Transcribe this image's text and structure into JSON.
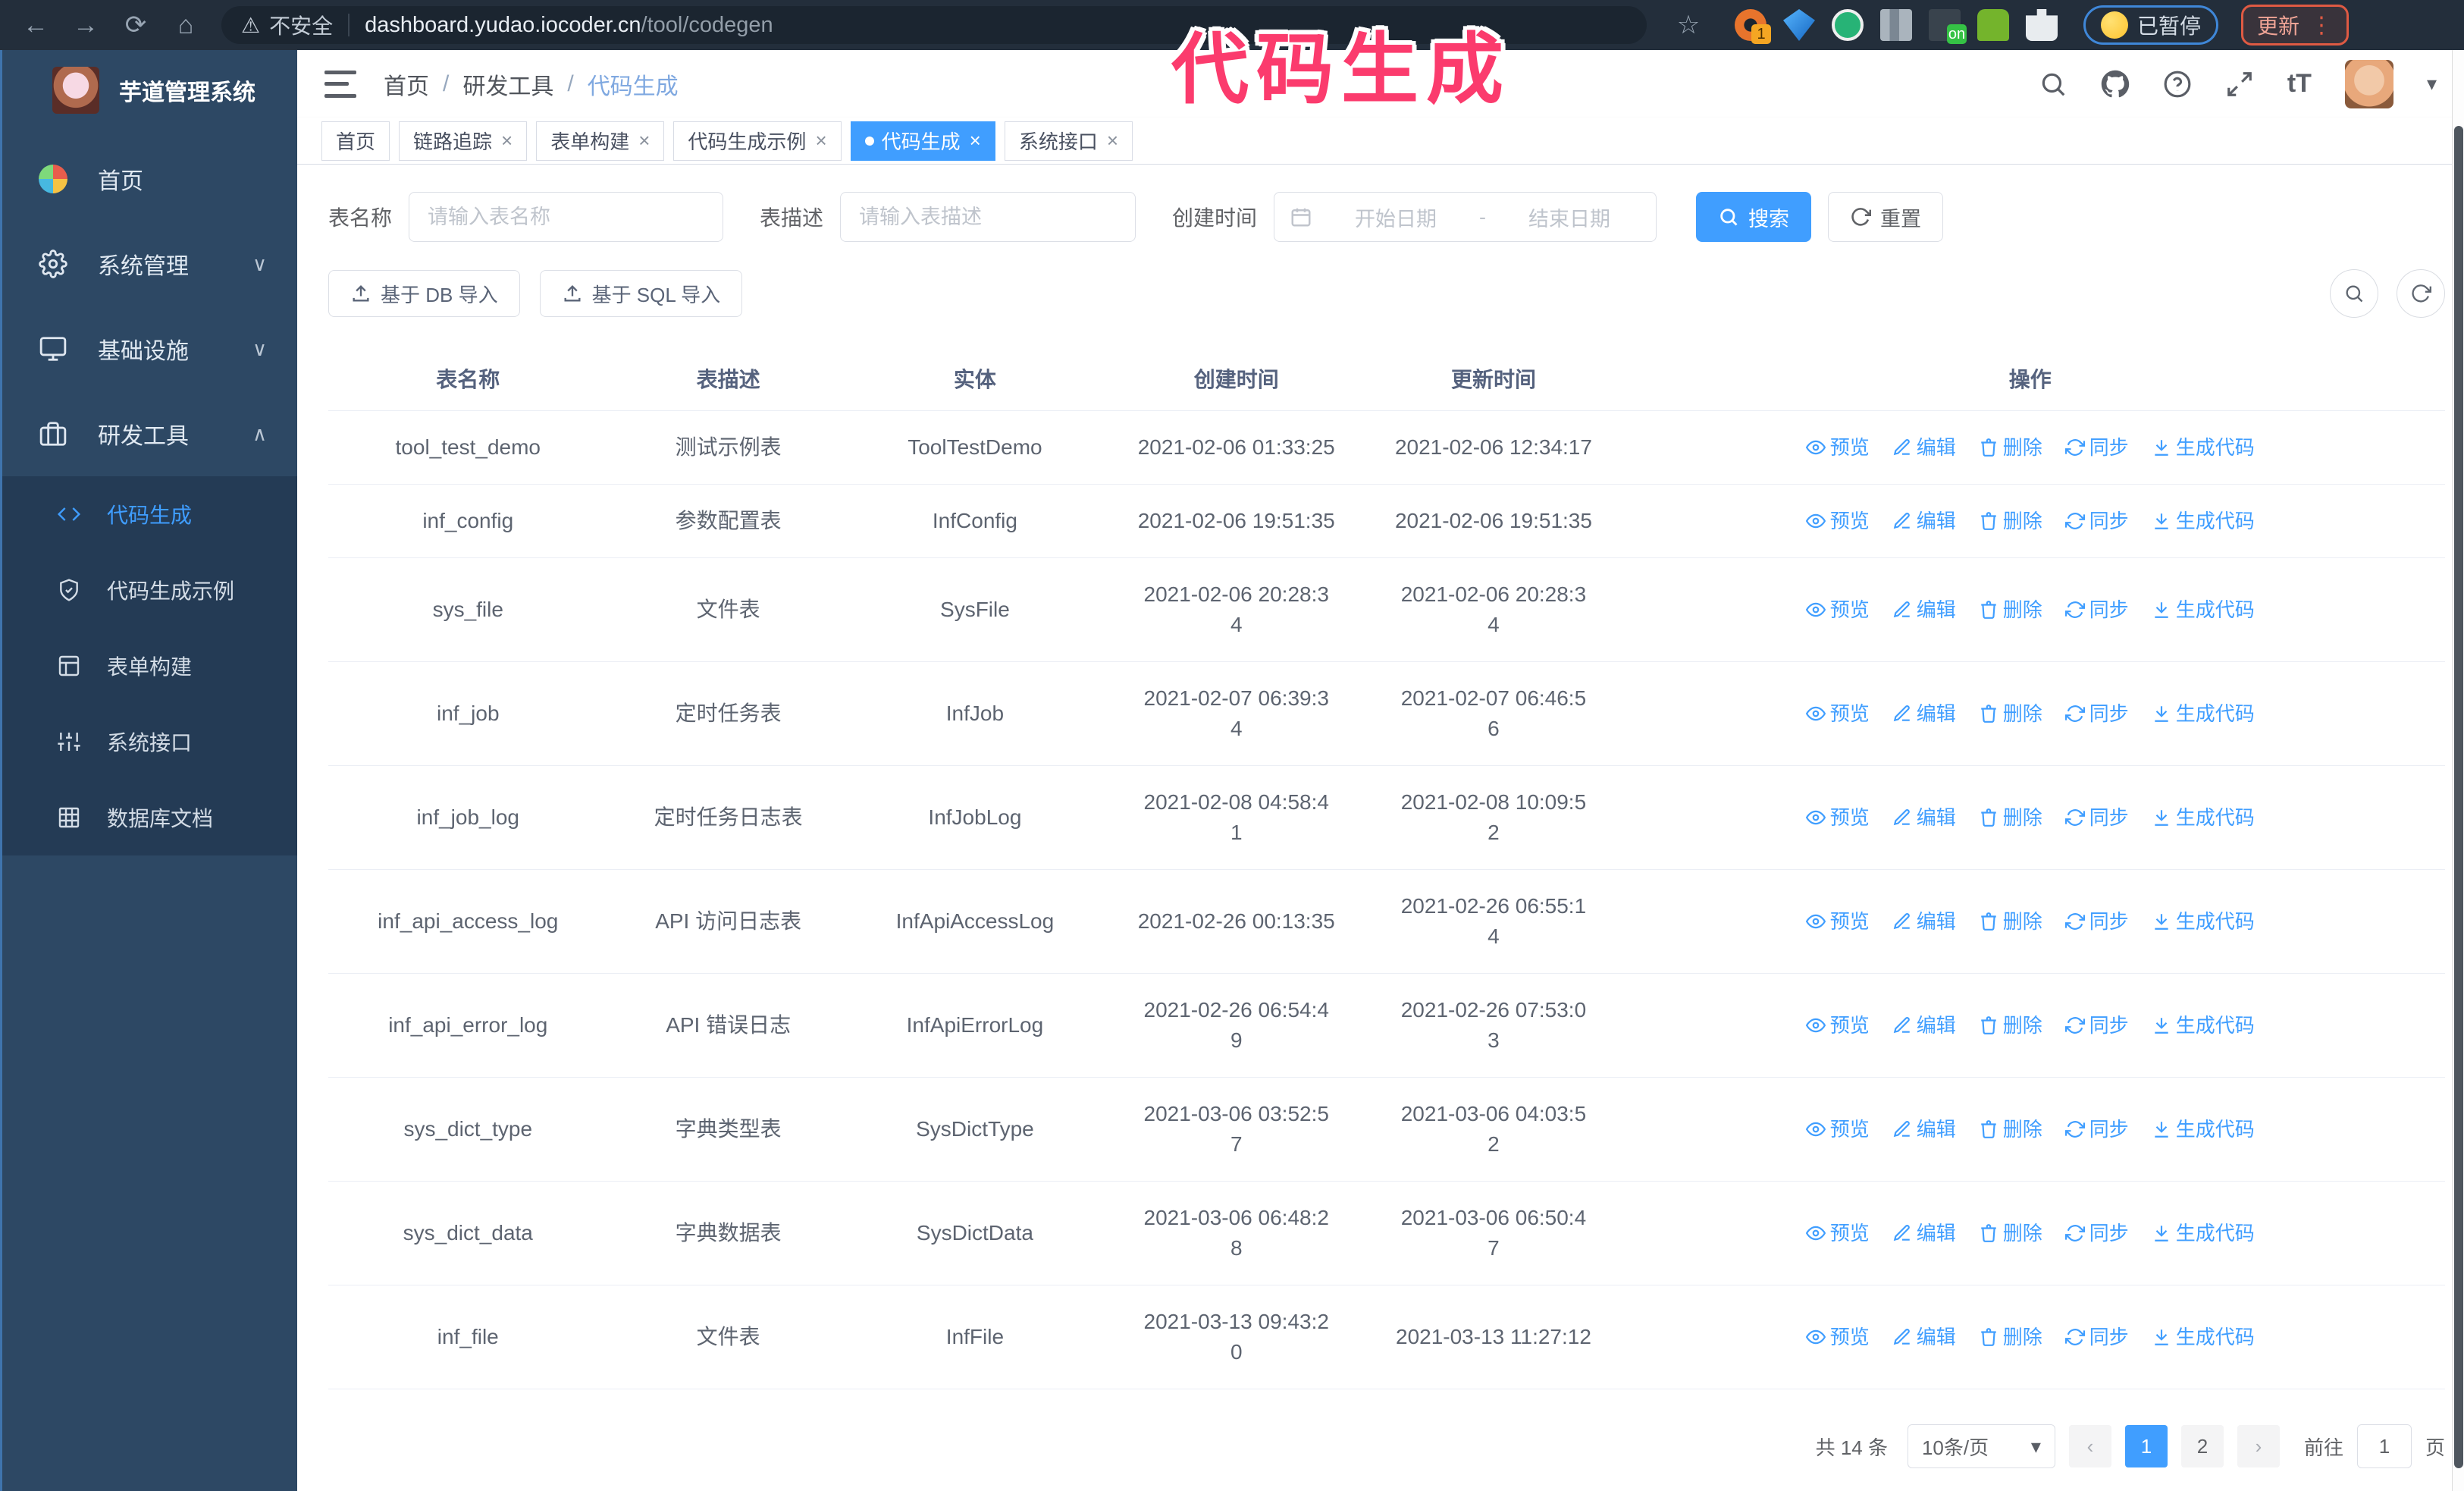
{
  "annotation": {
    "text": "代码生成",
    "color": "#fb3b6d"
  },
  "icons": {
    "back": "←",
    "forward": "→",
    "reload": "⟳",
    "home": "⌂",
    "warning": "⚠",
    "star": "☆",
    "kebab": "⋮",
    "caret_down": "▾",
    "close": "×",
    "chevron_down": "∨",
    "chevron_up": "∧",
    "prev_page": "‹",
    "next_page": "›"
  },
  "browser": {
    "insecure_label": "不安全",
    "url_host": "dashboard.yudao.iocoder.cn",
    "url_path": "/tool/codegen",
    "paused_badge": "已暂停",
    "update_button": "更新"
  },
  "sidebar": {
    "title": "芋道管理系统",
    "items": [
      {
        "label": "首页",
        "icon": "dashboard-pie"
      },
      {
        "label": "系统管理",
        "icon": "gear"
      },
      {
        "label": "基础设施",
        "icon": "monitor"
      },
      {
        "label": "研发工具",
        "icon": "briefcase"
      }
    ],
    "submenu": [
      {
        "label": "代码生成",
        "icon": "code",
        "active": true
      },
      {
        "label": "代码生成示例",
        "icon": "shield-check"
      },
      {
        "label": "表单构建",
        "icon": "form"
      },
      {
        "label": "系统接口",
        "icon": "sliders"
      },
      {
        "label": "数据库文档",
        "icon": "grid"
      }
    ]
  },
  "header": {
    "breadcrumb": [
      "首页",
      "研发工具",
      "代码生成"
    ],
    "separator": "/"
  },
  "tabs": [
    {
      "label": "首页"
    },
    {
      "label": "链路追踪",
      "closable": true
    },
    {
      "label": "表单构建",
      "closable": true
    },
    {
      "label": "代码生成示例",
      "closable": true
    },
    {
      "label": "代码生成",
      "closable": true,
      "active": true
    },
    {
      "label": "系统接口",
      "closable": true
    }
  ],
  "filters": {
    "table_name_label": "表名称",
    "table_name_placeholder": "请输入表名称",
    "table_desc_label": "表描述",
    "table_desc_placeholder": "请输入表描述",
    "create_time_label": "创建时间",
    "date_start_placeholder": "开始日期",
    "date_separator": "-",
    "date_end_placeholder": "结束日期",
    "search_label": "搜索",
    "reset_label": "重置"
  },
  "toolbar": {
    "import_db_label": "基于 DB 导入",
    "import_sql_label": "基于 SQL 导入"
  },
  "table": {
    "columns": [
      "表名称",
      "表描述",
      "实体",
      "创建时间",
      "更新时间",
      "操作"
    ],
    "row_actions": [
      "预览",
      "编辑",
      "删除",
      "同步",
      "生成代码"
    ],
    "rows": [
      {
        "name": "tool_test_demo",
        "desc": "测试示例表",
        "entity": "ToolTestDemo",
        "create_time": "2021-02-06 01:33:25",
        "update_time": "2021-02-06 12:34:17"
      },
      {
        "name": "inf_config",
        "desc": "参数配置表",
        "entity": "InfConfig",
        "create_time": "2021-02-06 19:51:35",
        "update_time": "2021-02-06 19:51:35"
      },
      {
        "name": "sys_file",
        "desc": "文件表",
        "entity": "SysFile",
        "create_time": "2021-02-06 20:28:3\n4",
        "update_time": "2021-02-06 20:28:3\n4"
      },
      {
        "name": "inf_job",
        "desc": "定时任务表",
        "entity": "InfJob",
        "create_time": "2021-02-07 06:39:3\n4",
        "update_time": "2021-02-07 06:46:5\n6"
      },
      {
        "name": "inf_job_log",
        "desc": "定时任务日志表",
        "entity": "InfJobLog",
        "create_time": "2021-02-08 04:58:4\n1",
        "update_time": "2021-02-08 10:09:5\n2"
      },
      {
        "name": "inf_api_access_log",
        "desc": "API 访问日志表",
        "entity": "InfApiAccessLog",
        "create_time": "2021-02-26 00:13:35",
        "update_time": "2021-02-26 06:55:1\n4"
      },
      {
        "name": "inf_api_error_log",
        "desc": "API 错误日志",
        "entity": "InfApiErrorLog",
        "create_time": "2021-02-26 06:54:4\n9",
        "update_time": "2021-02-26 07:53:0\n3"
      },
      {
        "name": "sys_dict_type",
        "desc": "字典类型表",
        "entity": "SysDictType",
        "create_time": "2021-03-06 03:52:5\n7",
        "update_time": "2021-03-06 04:03:5\n2"
      },
      {
        "name": "sys_dict_data",
        "desc": "字典数据表",
        "entity": "SysDictData",
        "create_time": "2021-03-06 06:48:2\n8",
        "update_time": "2021-03-06 06:50:4\n7"
      },
      {
        "name": "inf_file",
        "desc": "文件表",
        "entity": "InfFile",
        "create_time": "2021-03-13 09:43:2\n0",
        "update_time": "2021-03-13 11:27:12"
      }
    ]
  },
  "pagination": {
    "total_label": "共 14 条",
    "page_size": "10条/页",
    "pages": [
      "1",
      "2"
    ],
    "active_page": "1",
    "goto_label": "前往",
    "goto_value": "1",
    "page_suffix": "页"
  },
  "colors": {
    "accent": "#409eff",
    "sidebar_bg": "#2d4864",
    "submenu_bg": "#243b55",
    "browser_bar_bg": "#232e3b",
    "annotation": "#fb3b6d",
    "update_button_border": "#df5a43",
    "paused_pill_border": "#3f87d8"
  }
}
